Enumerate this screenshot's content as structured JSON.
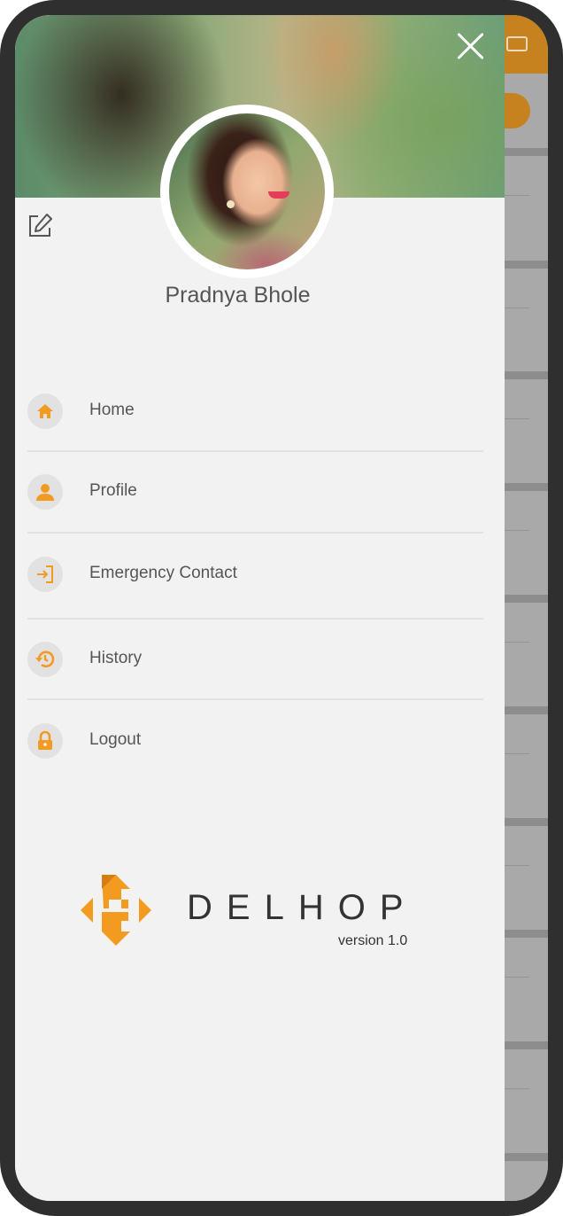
{
  "user": {
    "name": "Pradnya Bhole"
  },
  "menu": {
    "items": [
      {
        "label": "Home",
        "icon": "home-icon"
      },
      {
        "label": "Profile",
        "icon": "person-icon"
      },
      {
        "label": "Emergency Contact",
        "icon": "login-icon"
      },
      {
        "label": "History",
        "icon": "history-icon"
      },
      {
        "label": "Logout",
        "icon": "lock-icon"
      }
    ]
  },
  "brand": {
    "name": "DELHOP",
    "version": "version 1.0"
  },
  "colors": {
    "accent": "#f39a21",
    "drawer_bg": "#f2f2f2",
    "text": "#555555",
    "header_behind": "#c78220"
  }
}
